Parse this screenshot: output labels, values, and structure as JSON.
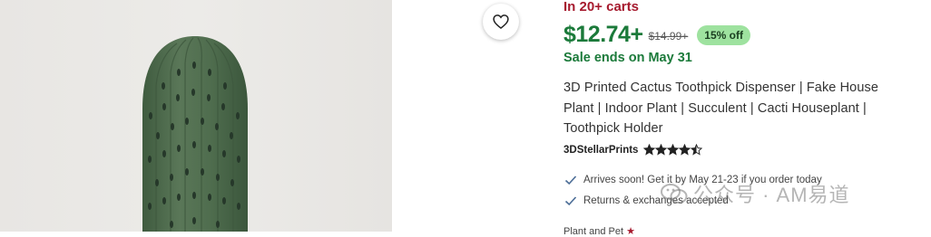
{
  "listing": {
    "social_proof": "In 20+ carts",
    "price": "$12.74+",
    "original_price": "$14.99+",
    "discount_badge": "15% off",
    "sale_ends": "Sale ends on May 31",
    "title": "3D Printed Cactus Toothpick Dispenser | Fake House Plant | Indoor Plant | Succulent | Cacti Houseplant | Toothpick Holder",
    "seller": "3DStellarPrints",
    "rating": 4.5,
    "perks": [
      {
        "text": "Arrives soon! Get it by May 21-23 if you order today",
        "icon": "check-icon"
      },
      {
        "text": "Returns & exchanges accepted",
        "icon": "check-icon"
      }
    ],
    "truncated_line": "Plant and Pet",
    "truncated_mark": "★"
  },
  "favorite": {
    "icon": "heart-icon"
  },
  "watermark": {
    "text": "公众号 · AM易道"
  },
  "colors": {
    "price_green": "#1b7a3a",
    "carts_red": "#a61a2e",
    "discount_bg": "#9ee29f",
    "cactus_green": "#4f6d4e"
  }
}
